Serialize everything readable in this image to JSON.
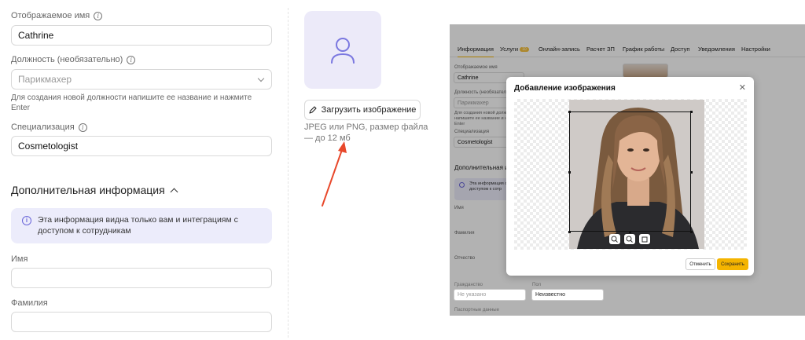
{
  "form": {
    "display_name_label": "Отображаемое имя",
    "display_name_value": "Cathrine",
    "position_label": "Должность (необязательно)",
    "position_value": "Парикмахер",
    "position_hint": "Для создания новой должности напишите ее название и нажмите Enter",
    "specialization_label": "Специализация",
    "specialization_value": "Cosmetologist",
    "extra_section_title": "Дополнительная информация",
    "info_text": "Эта информация видна только вам и интеграциям с доступом к сотрудникам",
    "first_name_label": "Имя",
    "last_name_label": "Фамилия"
  },
  "upload": {
    "button_label": "Загрузить изображение",
    "hint": "JPEG или PNG, размер файла — до 12 мб"
  },
  "arrow_color": "#e8482b",
  "screenshot": {
    "tabs": [
      {
        "label": "Информация",
        "active": true
      },
      {
        "label": "Услуги",
        "badge": "10"
      },
      {
        "label": "Онлайн-запись"
      },
      {
        "label": "Расчет ЗП"
      },
      {
        "label": "График работы"
      },
      {
        "label": "Доступ"
      },
      {
        "label": "Уведомления"
      },
      {
        "label": "Настройки"
      }
    ],
    "display_name_label": "Отображаемое имя",
    "display_name_value": "Cathrine",
    "position_label": "Должность (необязательно)",
    "position_value": "Парикмахер",
    "position_hint": "Для создания новой должности напишите ее название и нажмите Enter",
    "specialization_label": "Специализация",
    "specialization_value": "Cosmetologist",
    "extra_section_title": "Дополнительная и",
    "info_text": "Эта информация с доступом к сотр",
    "first_name_label": "Имя",
    "last_name_label": "Фамилия",
    "patronymic_label": "Отчество",
    "citizenship_label": "Гражданство",
    "citizenship_placeholder": "Не указано",
    "gender_label": "Пол",
    "gender_value": "Неизвестно",
    "passport_label": "Паспортные данные",
    "modal": {
      "title": "Добавление изображения",
      "cancel_label": "Отменить",
      "save_label": "Сохранить",
      "accent_color": "#f4b400"
    }
  }
}
